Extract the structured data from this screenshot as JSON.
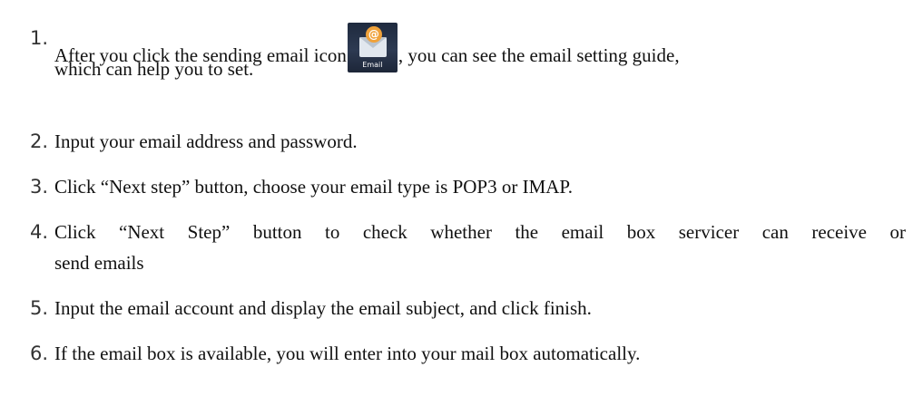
{
  "steps": [
    {
      "number": "1.",
      "before_icon": "After you click the sending email icon",
      "icon": {
        "name": "email-app-icon",
        "label": "Email"
      },
      "after_icon": ", you can see the email setting guide,",
      "continuation": "which can help you to set."
    },
    {
      "number": "2.",
      "text": "Input your email address and password."
    },
    {
      "number": "3.",
      "text": "Click “Next step” button, choose your email type is POP3 or IMAP."
    },
    {
      "number": "4.",
      "line1_words": [
        "Click",
        "“Next",
        "Step”",
        "button",
        "to",
        "check",
        "whether",
        "the",
        "email",
        "box",
        "servicer",
        "can",
        "receive",
        "or"
      ],
      "continuation": "send emails"
    },
    {
      "number": "5.",
      "text": "Input the email account and display the email subject, and click finish."
    },
    {
      "number": "6.",
      "text": "If the email box is available, you will enter into your mail box automatically."
    }
  ]
}
